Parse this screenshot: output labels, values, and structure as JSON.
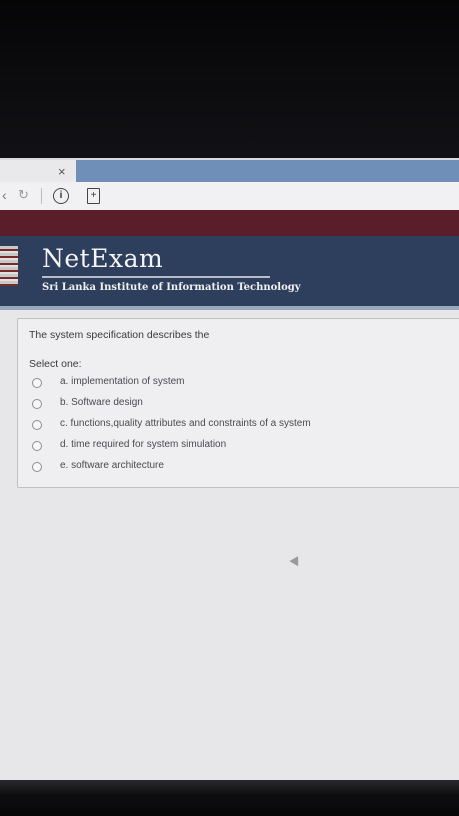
{
  "browser": {
    "tab_close": "×",
    "icons": [
      "back-icon",
      "reload-icon",
      "info-icon",
      "page-icon"
    ]
  },
  "header": {
    "brand": "NetExam",
    "subtitle": "Sri Lanka Institute of Information Technology"
  },
  "question": {
    "text": "The system specification describes the",
    "select_label": "Select one:",
    "options": [
      {
        "label": "a. implementation of system",
        "selected": false
      },
      {
        "label": "b. Software design",
        "selected": false
      },
      {
        "label": "c. functions,quality attributes and constraints of a system",
        "selected": false
      },
      {
        "label": "d. time required for system simulation",
        "selected": false
      },
      {
        "label": "e. software architecture",
        "selected": false
      }
    ]
  },
  "colors": {
    "header_bg": "#2e3f5d",
    "maroon_bar": "#5a1e2a",
    "tab_blue": "#6f8fb8"
  }
}
